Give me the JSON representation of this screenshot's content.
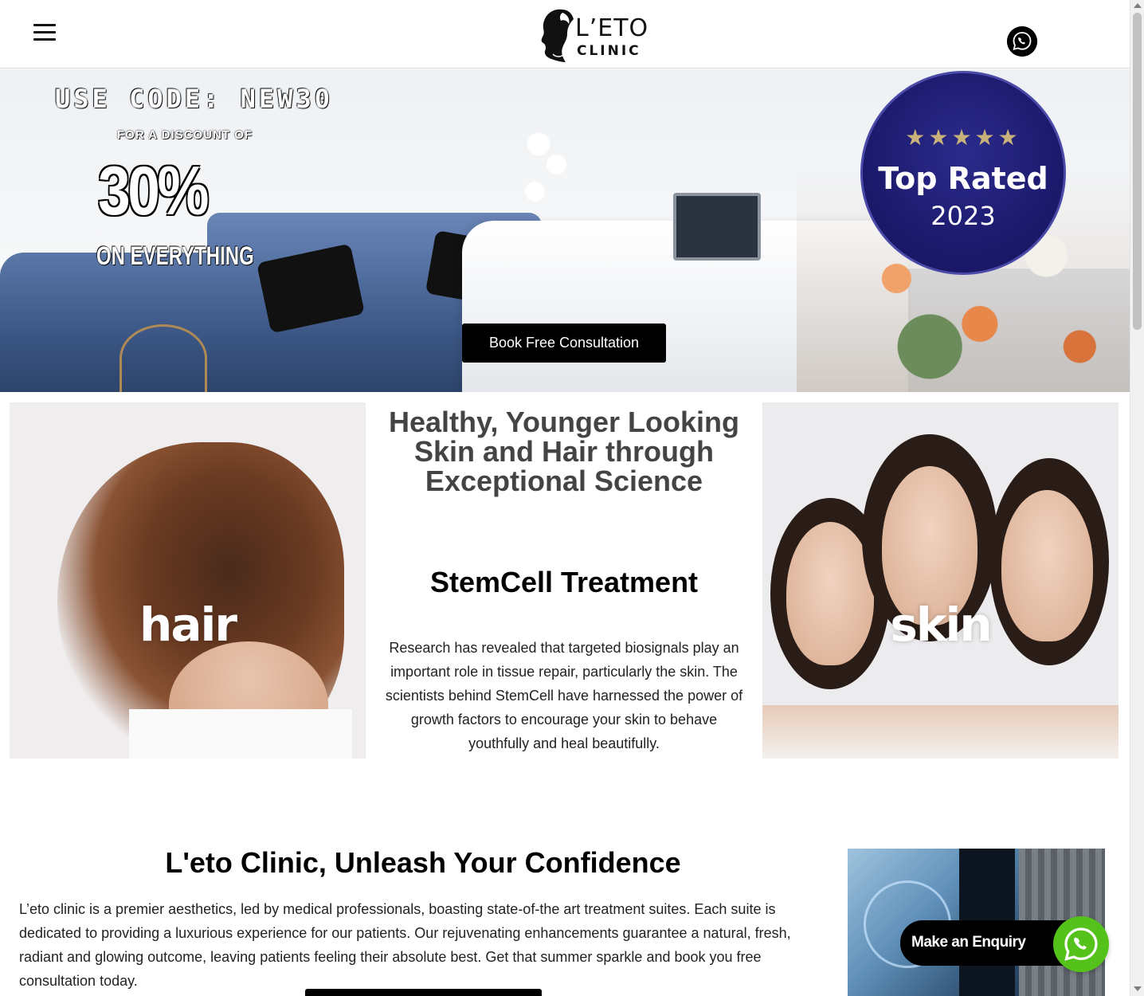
{
  "header": {
    "logo_line1": "L’ETO",
    "logo_line2": "CLINIC"
  },
  "hero": {
    "promo_code": "USE CODE: NEW30",
    "promo_sub": "FOR A DISCOUNT OF",
    "promo_percent": "30%",
    "promo_scope": "ON EVERYTHING",
    "badge_stars": "★★★★★",
    "badge_title": "Top Rated",
    "badge_year": "2023",
    "cta_label": "Book Free Consultation"
  },
  "treatments": {
    "left_card_label": "hair",
    "right_card_label": "skin",
    "tagline": "Healthy, Younger Looking Skin and Hair through Exceptional Science",
    "title": "StemCell Treatment",
    "description": "Research has revealed that targeted biosignals play an important role in tissue repair, particularly the skin. The scientists behind StemCell have harnessed the power of growth factors to encourage your skin to behave youthfully and heal beautifully."
  },
  "about": {
    "title": "L'eto Clinic, Unleash Your Confidence",
    "text": "L’eto clinic is a premier aesthetics, led by medical professionals, boasting state-of-the art treatment suites. Each suite is dedicated to providing a luxurious experience for our patients. Our rejuvenating enhancements guarantee a natural, fresh, radiant and glowing outcome, leaving patients feeling their absolute best. Get that summer sparkle and book you free consultation today."
  },
  "floating": {
    "enquiry_label": "Make an Enquiry"
  },
  "icons": {
    "menu": "hamburger-menu-icon",
    "whatsapp": "whatsapp-icon"
  },
  "colors": {
    "badge_bg": "#1c1a6d",
    "badge_stars": "#c9b27a",
    "whatsapp_green": "#55c21b",
    "button_bg": "#000000"
  }
}
